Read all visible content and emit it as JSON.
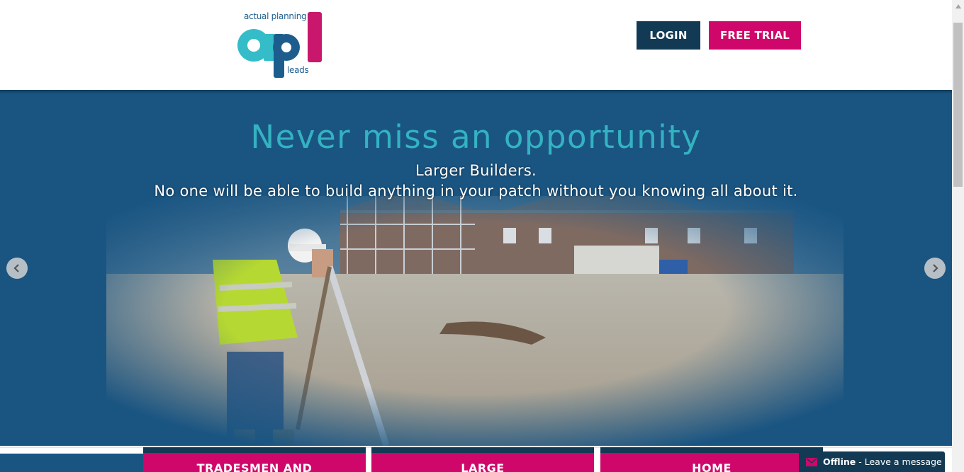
{
  "header": {
    "logo_tag_top": "actual planning",
    "logo_tag_bottom": "leads",
    "login_label": "LOGIN",
    "trial_label": "FREE TRIAL"
  },
  "hero": {
    "title": "Never miss an opportunity",
    "subtitle_line1": "Larger Builders.",
    "subtitle_line2": "No one will be able to build anything in your patch without you knowing all about it."
  },
  "cards": [
    {
      "label": "TRADESMEN AND"
    },
    {
      "label": "LARGE"
    },
    {
      "label": "HOME"
    }
  ],
  "chat": {
    "status": "Offline",
    "message": "- Leave a message"
  },
  "colors": {
    "brand_navy": "#123a55",
    "brand_pink": "#d0076a",
    "brand_teal": "#34b2c2",
    "hero_blue": "#1a5582"
  },
  "icons": {
    "prev": "chevron-left-icon",
    "next": "chevron-right-icon",
    "chat": "envelope-icon"
  }
}
